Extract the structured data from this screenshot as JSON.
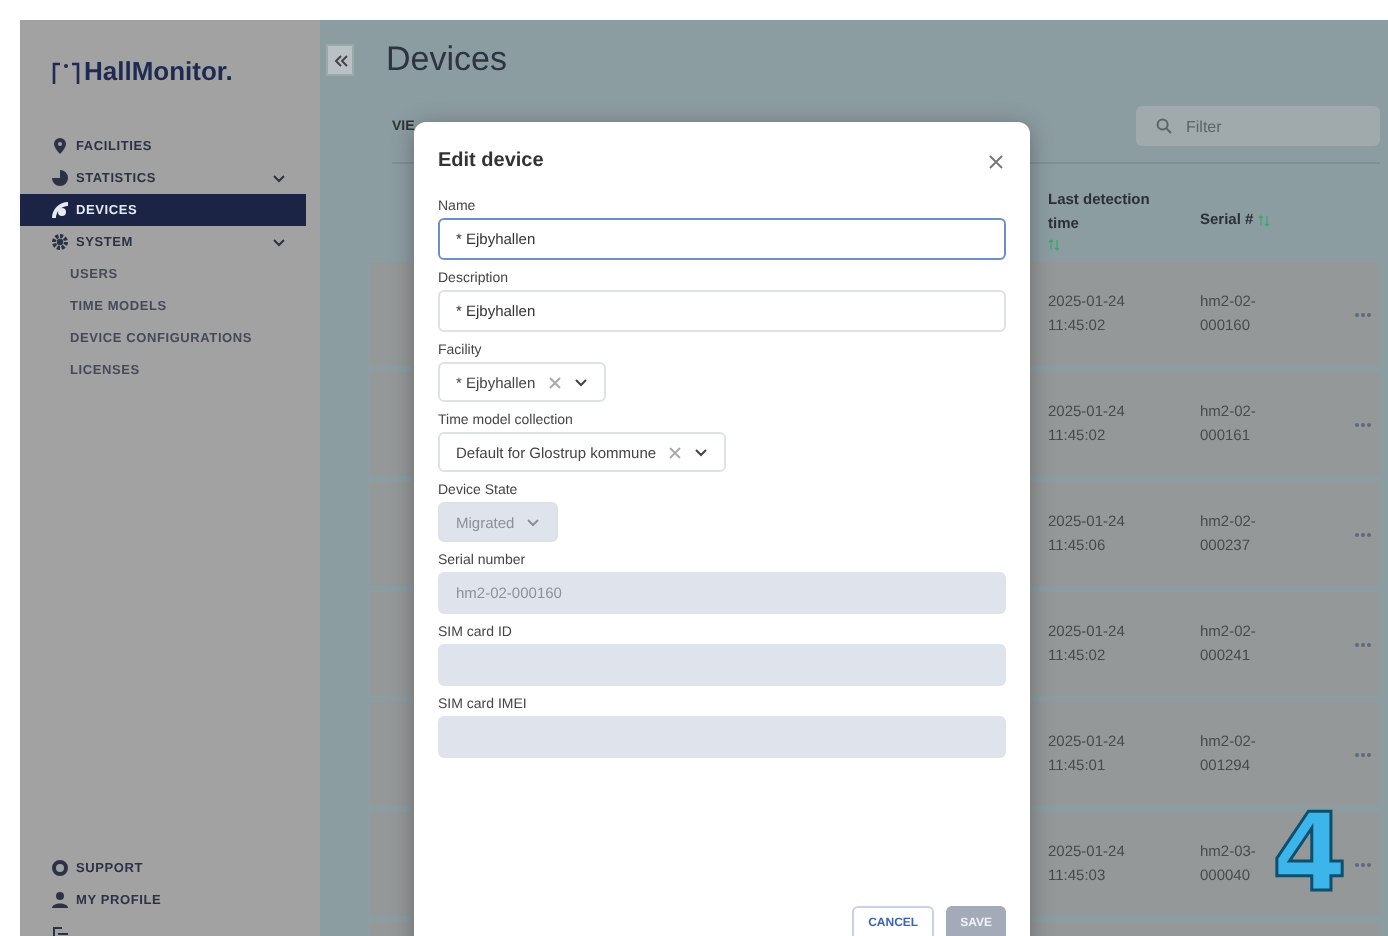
{
  "sidebar": {
    "logo": "HallMonitor.",
    "items": [
      {
        "label": "FACILITIES",
        "kind": "link",
        "selected": false
      },
      {
        "label": "STATISTICS",
        "kind": "group",
        "selected": false
      },
      {
        "label": "DEVICES",
        "kind": "link",
        "selected": true
      },
      {
        "label": "SYSTEM",
        "kind": "group",
        "selected": false
      },
      {
        "label": "USERS",
        "kind": "sub",
        "selected": false
      },
      {
        "label": "TIME MODELS",
        "kind": "sub",
        "selected": false
      },
      {
        "label": "DEVICE CONFIGURATIONS",
        "kind": "sub",
        "selected": false
      },
      {
        "label": "LICENSES",
        "kind": "sub",
        "selected": false
      }
    ],
    "footer": [
      {
        "label": "SUPPORT"
      },
      {
        "label": "MY PROFILE"
      }
    ]
  },
  "page": {
    "title": "Devices",
    "tab": "VIE",
    "filter": {
      "placeholder": "Filter"
    }
  },
  "table": {
    "columns": [
      "Last detection time",
      "Serial #"
    ],
    "rows": [
      {
        "time": "2025-01-24 11:45:02",
        "serial": "hm2-02-000160"
      },
      {
        "time": "2025-01-24 11:45:02",
        "serial": "hm2-02-000161"
      },
      {
        "time": "2025-01-24 11:45:06",
        "serial": "hm2-02-000237"
      },
      {
        "time": "2025-01-24 11:45:02",
        "serial": "hm2-02-000241"
      },
      {
        "time": "2025-01-24 11:45:01",
        "serial": "hm2-02-001294"
      },
      {
        "time": "2025-01-24 11:45:03",
        "serial": "hm2-03-000040"
      }
    ]
  },
  "dialog": {
    "title": "Edit device",
    "fields": [
      {
        "label": "Name",
        "kind": "text",
        "value": "* Ejbyhallen",
        "focused": true,
        "disabled": false
      },
      {
        "label": "Description",
        "kind": "text",
        "value": "* Ejbyhallen",
        "focused": false,
        "disabled": false
      },
      {
        "label": "Facility",
        "kind": "select",
        "value": "* Ejbyhallen",
        "clearable": true,
        "disabled": false
      },
      {
        "label": "Time model collection",
        "kind": "select",
        "value": "Default for Glostrup kommune",
        "clearable": true,
        "disabled": false
      },
      {
        "label": "Device State",
        "kind": "select",
        "value": "Migrated",
        "clearable": false,
        "disabled": true
      },
      {
        "label": "Serial number",
        "kind": "text",
        "value": "hm2-02-000160",
        "focused": false,
        "disabled": true
      },
      {
        "label": "SIM card ID",
        "kind": "text",
        "focused": false,
        "disabled": true
      },
      {
        "label": "SIM card IMEI",
        "kind": "text",
        "focused": false,
        "disabled": true
      }
    ],
    "buttons": [
      {
        "label": "CANCEL",
        "disabled": false
      },
      {
        "label": "SAVE",
        "disabled": true
      }
    ]
  },
  "step_badge": "4"
}
